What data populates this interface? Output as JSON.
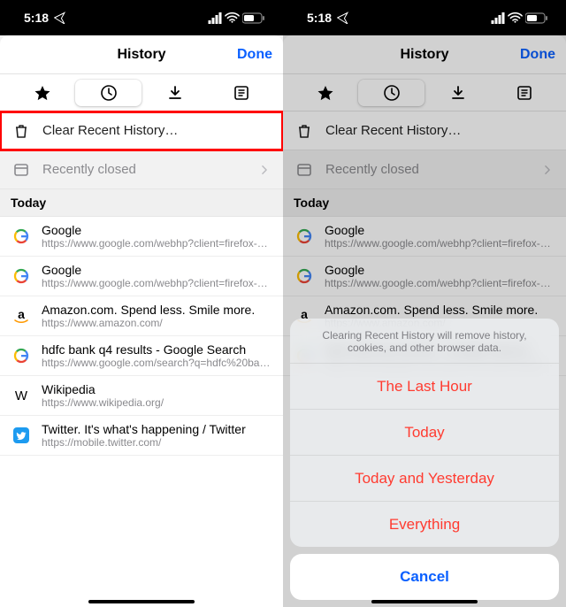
{
  "status": {
    "time": "5:18",
    "location_icon": "location",
    "signal_icon": "signal",
    "wifi_icon": "wifi",
    "battery_icon": "battery"
  },
  "header": {
    "title": "History",
    "done": "Done"
  },
  "tabs": {
    "bookmarks": "bookmarks",
    "history": "history",
    "downloads": "downloads",
    "reading": "reading-list"
  },
  "actions": {
    "clear": "Clear Recent History…",
    "recently_closed": "Recently closed"
  },
  "section": {
    "today": "Today"
  },
  "entries": [
    {
      "icon": "google",
      "title": "Google",
      "url": "https://www.google.com/webhp?client=firefox-b-m&…"
    },
    {
      "icon": "google",
      "title": "Google",
      "url": "https://www.google.com/webhp?client=firefox-b-m&…"
    },
    {
      "icon": "amazon",
      "title": "Amazon.com. Spend less. Smile more.",
      "url": "https://www.amazon.com/"
    },
    {
      "icon": "google",
      "title": "hdfc bank q4 results - Google Search",
      "url": "https://www.google.com/search?q=hdfc%20bank%2…"
    },
    {
      "icon": "wikipedia",
      "title": "Wikipedia",
      "url": "https://www.wikipedia.org/"
    },
    {
      "icon": "twitter",
      "title": "Twitter. It's what's happening / Twitter",
      "url": "https://mobile.twitter.com/"
    }
  ],
  "sheet": {
    "msg": "Clearing Recent History will remove history, cookies, and other browser data.",
    "opts": [
      "The Last Hour",
      "Today",
      "Today and Yesterday",
      "Everything"
    ],
    "cancel": "Cancel"
  }
}
